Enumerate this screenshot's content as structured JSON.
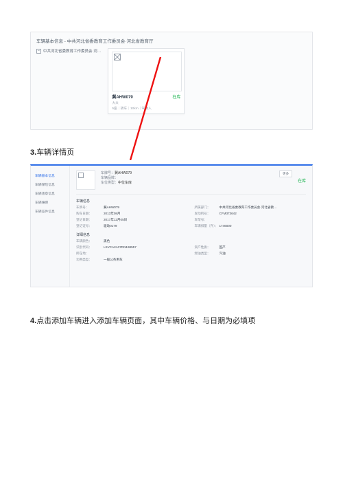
{
  "screenshot1": {
    "title": "车辆基本信息 - 中共河北省委教育工作委员会·河北省教育厅",
    "treeNode": "中共河北省委教育工作委员会·河…",
    "card": {
      "plate": "冀AHW079",
      "status": "在库",
      "sub1": "大众",
      "sub2": "5座｜轿车｜10km｜驾驶人"
    }
  },
  "sec3": {
    "num": "3.",
    "title": "车辆详情页"
  },
  "sec4": {
    "num": "4.",
    "title": "点击添加车辆进入添加车辆页面，其中车辆价格、与日期为必填项"
  },
  "detail": {
    "nav": {
      "n1": "车辆基本信息",
      "n2": "车辆保险信息",
      "n3": "车辆违章信息",
      "n4": "车辆维保",
      "n5": "车辆证件信息"
    },
    "head": {
      "plateLabel": "车牌号：",
      "plate": "冀AHW079",
      "brandLabel": "车辆品牌：",
      "typeLabel": "车位类型：",
      "typeVal": "中位车库",
      "more": "更多",
      "state": "在库"
    },
    "group1": "车辆信息",
    "row": {
      "k1": "车牌号：",
      "v1": "冀AHW079",
      "k2": "所属部门：",
      "v2": "中共河北省委教育工作委员会·河北省教…",
      "k3": "购车日期：",
      "v3": "2013年08月",
      "k4": "发动机号：",
      "v4": "CFM373642",
      "k5": "登记日期：",
      "v5": "2017年12月05日",
      "k6": "车架号：",
      "v6": "",
      "k7": "登记证号：",
      "v7": "驱动0179",
      "k8": "车辆排量（升）：",
      "v8": "1746000"
    },
    "group2": "详细信息",
    "row2": {
      "k1": "车辆颜色：",
      "v1": "黑色",
      "k2": "识别代码：",
      "v2": "LSVCA2A37DN198557",
      "k3": "资产性质：",
      "v3": "固产",
      "k4": "所在地：",
      "v4": "",
      "k5": "燃油类型：",
      "v5": "汽油",
      "k6": "功用类型：",
      "v6": "一般公务用车"
    }
  }
}
